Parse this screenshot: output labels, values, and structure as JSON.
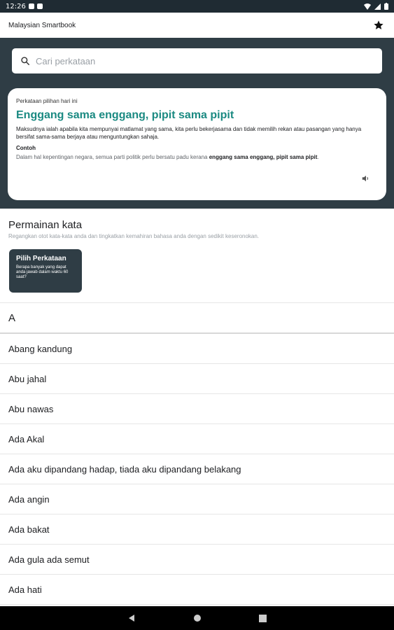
{
  "status_bar": {
    "time": "12:26"
  },
  "app_bar": {
    "title": "Malaysian Smartbook",
    "favorite_icon": "star-icon"
  },
  "search": {
    "placeholder": "Cari perkataan",
    "value": ""
  },
  "word_of_day": {
    "heading": "Perkataan pilihan hari ini",
    "title": "Enggang sama enggang, pipit sama pipit",
    "meaning": "Maksudnya ialah apabila kita mempunyai matlamat yang sama, kita perlu bekerjasama dan tidak memilih rekan atau pasangan yang hanya bersifat sama-sama berjaya atau menguntungkan sahaja.",
    "example_label": "Contoh",
    "example_prefix": "Dalam hal kepentingan negara, semua parti politik perlu bersatu padu kerana ",
    "example_bold": "enggang sama enggang, pipit sama pipit",
    "example_suffix": ".",
    "accent_color": "#1b8a82"
  },
  "games": {
    "title": "Permainan kata",
    "subtitle": "Regangkan otot kata-kata anda dan tingkatkan kemahiran bahasa anda dengan sedikit keseronokan.",
    "card_title": "Pilih Perkataan",
    "card_desc": "Berapa banyak yang dapat anda jawab dalam waktu 60 saat?"
  },
  "list": {
    "letter": "A",
    "items": [
      "Abang kandung",
      "Abu jahal",
      "Abu nawas",
      "Ada Akal",
      "Ada aku dipandang hadap, tiada aku dipandang belakang",
      "Ada angin",
      "Ada bakat",
      "Ada gula ada semut",
      "Ada hati"
    ]
  }
}
